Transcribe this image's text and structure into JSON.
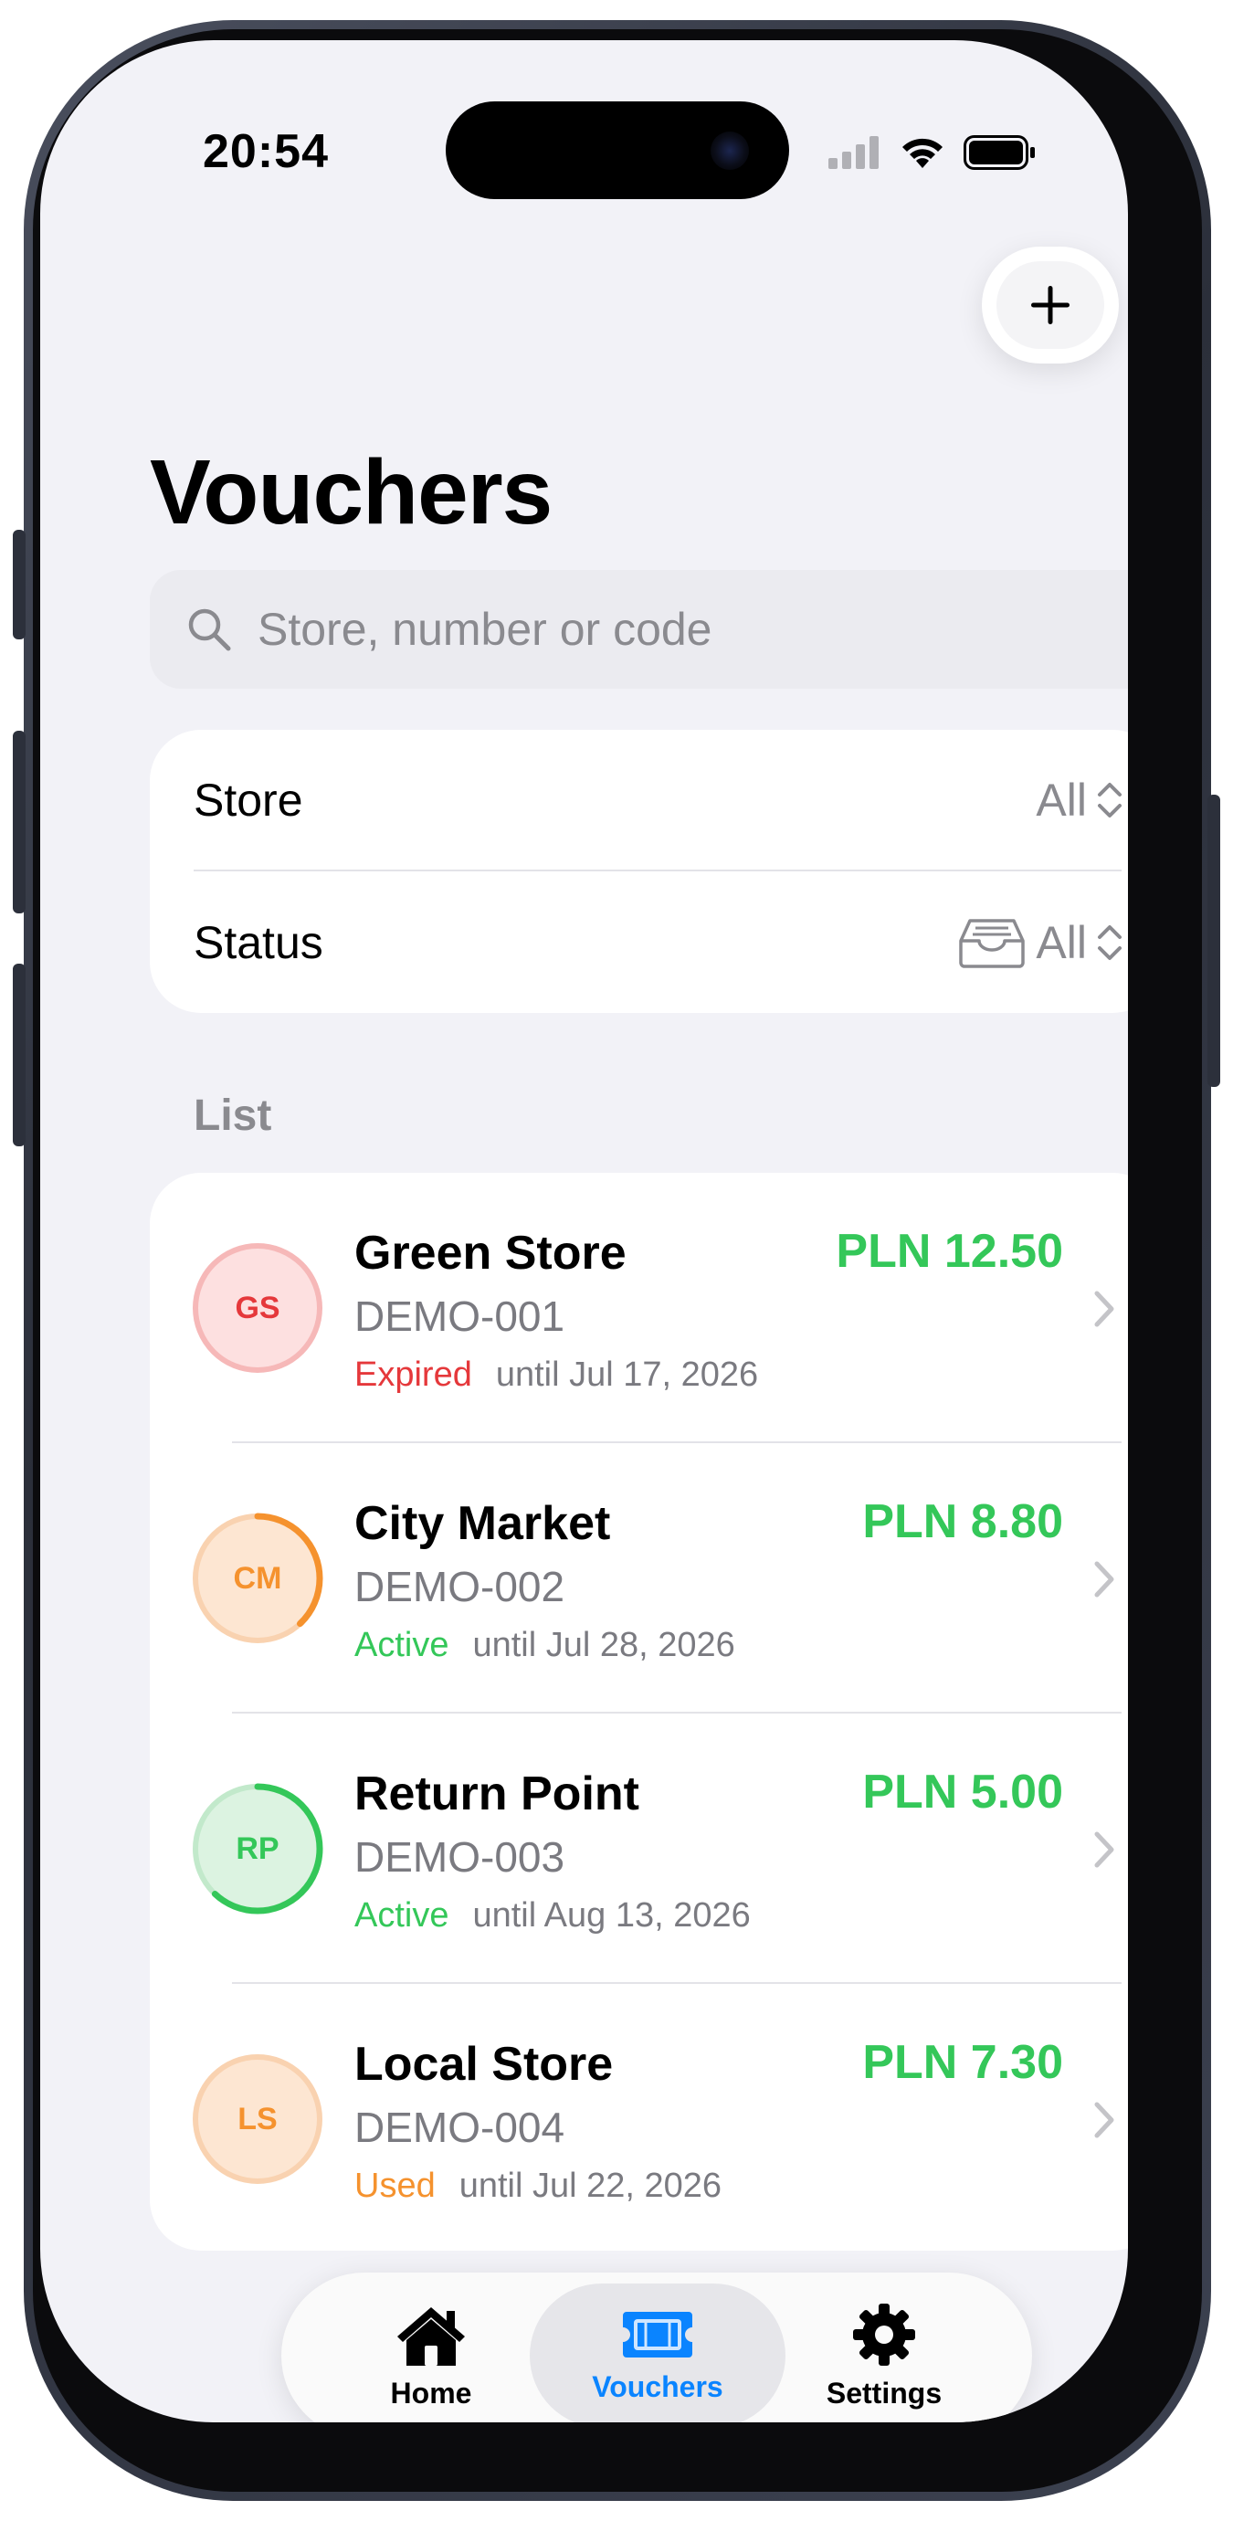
{
  "status_bar": {
    "time": "20:54"
  },
  "header": {
    "title": "Vouchers",
    "add_button": "+"
  },
  "search": {
    "placeholder": "Store, number or code"
  },
  "filters": {
    "store": {
      "label": "Store",
      "value": "All"
    },
    "status": {
      "label": "Status",
      "value": "All"
    }
  },
  "list": {
    "section_title": "List",
    "items": [
      {
        "initials": "GS",
        "store": "Green Store",
        "code": "DEMO-001",
        "status": "Expired",
        "until": "until Jul 17, 2026",
        "amount": "PLN 12.50",
        "status_color": "#e5383b",
        "avatar_bg": "#fde0e0",
        "avatar_ring": "#f6b8b8",
        "progress": 0,
        "progress_color": "#e5383b"
      },
      {
        "initials": "CM",
        "store": "City Market",
        "code": "DEMO-002",
        "status": "Active",
        "until": "until Jul 28, 2026",
        "amount": "PLN 8.80",
        "status_color": "#34c759",
        "avatar_bg": "#fde6d2",
        "avatar_ring": "#f9d2b0",
        "progress": 0.38,
        "progress_color": "#f5922e"
      },
      {
        "initials": "RP",
        "store": "Return Point",
        "code": "DEMO-003",
        "status": "Active",
        "until": "until Aug 13, 2026",
        "amount": "PLN 5.00",
        "status_color": "#34c759",
        "avatar_bg": "#dcf3e1",
        "avatar_ring": "#c2e9cb",
        "progress": 0.62,
        "progress_color": "#34c759"
      },
      {
        "initials": "LS",
        "store": "Local Store",
        "code": "DEMO-004",
        "status": "Used",
        "until": "until Jul 22, 2026",
        "amount": "PLN 7.30",
        "status_color": "#f5922e",
        "avatar_bg": "#fde6d2",
        "avatar_ring": "#f9d2b0",
        "progress": 0,
        "progress_color": "#f5922e"
      }
    ]
  },
  "tabbar": {
    "tabs": [
      {
        "label": "Home",
        "icon": "house-icon"
      },
      {
        "label": "Vouchers",
        "icon": "ticket-icon",
        "active": true
      },
      {
        "label": "Settings",
        "icon": "gear-icon"
      }
    ]
  },
  "colors": {
    "accent": "#0a84ff",
    "amount": "#34c759"
  }
}
